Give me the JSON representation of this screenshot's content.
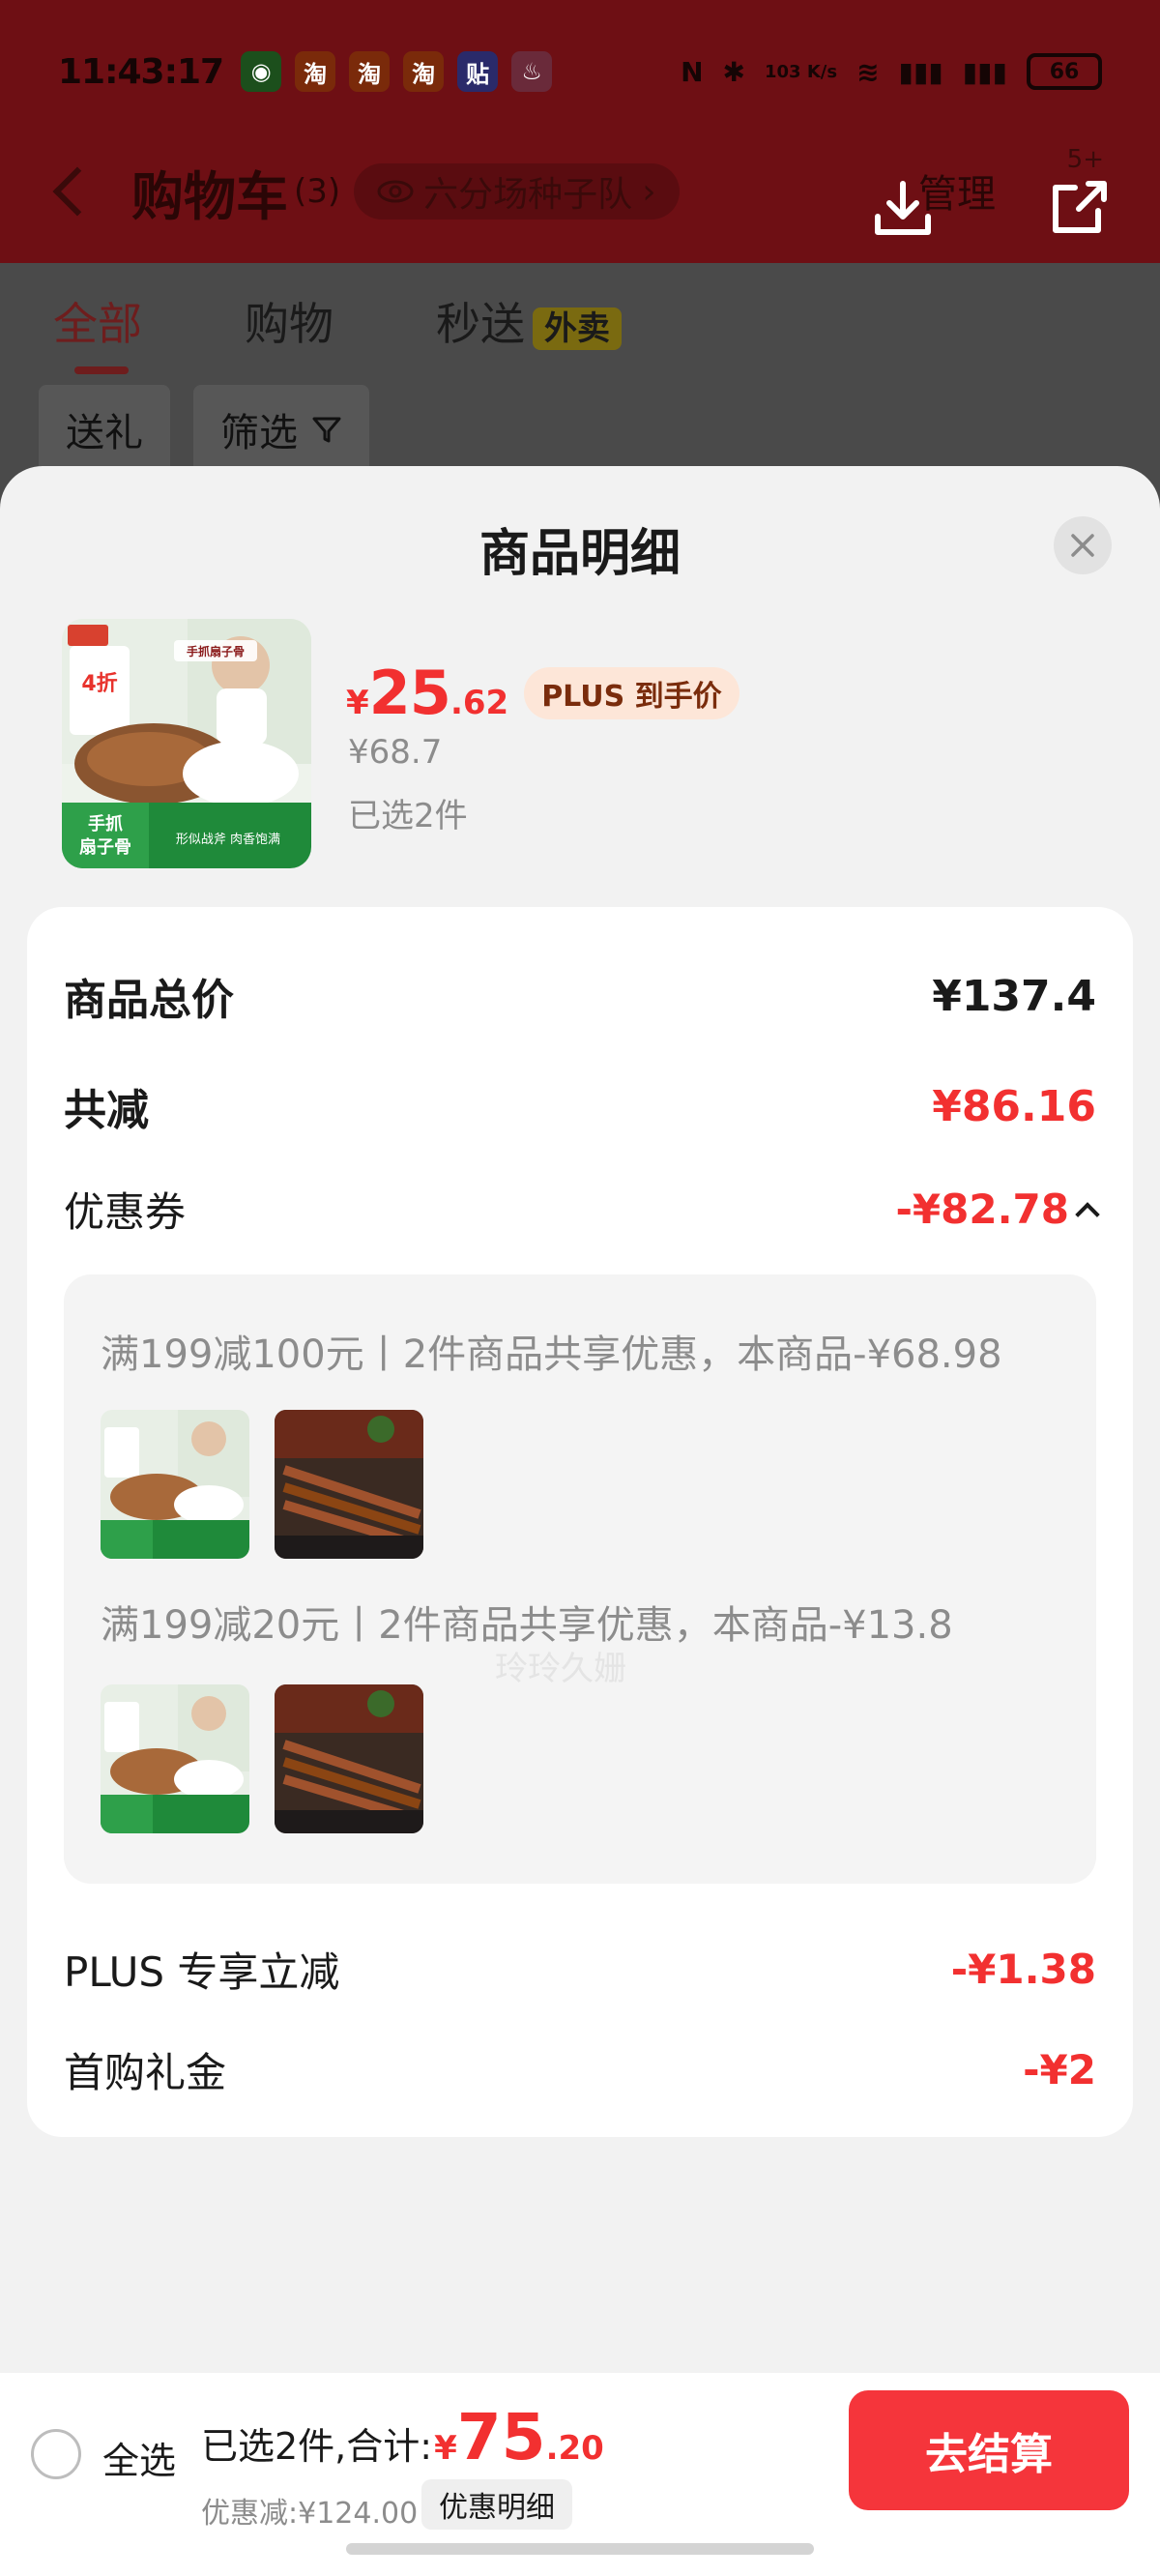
{
  "status_bar": {
    "time": "11:43:17",
    "battery": "66",
    "speed": "103 K/s"
  },
  "nav": {
    "title": "购物车",
    "count": "(3)",
    "team": "六分场种子队",
    "manage": "管理",
    "badge": "5+"
  },
  "tabs": {
    "all": "全部",
    "shop": "购物",
    "instant": "秒送",
    "takeout": "外卖"
  },
  "filters": {
    "gift": "送礼",
    "filter": "筛选"
  },
  "sheet": {
    "title": "商品明细",
    "product": {
      "price_symbol": "¥",
      "price_int": "25",
      "price_dec": ".62",
      "plus_tag": "PLUS 到手价",
      "original_price": "¥68.7",
      "selected": "已选2件",
      "img_text_brand": "手抓扇子骨",
      "img_text_left": "手抓\n扇子骨",
      "img_text_slogan": "形似战斧 肉香饱满"
    },
    "summary": {
      "total_label": "商品总价",
      "total_value": "¥137.4",
      "reduce_label": "共减",
      "reduce_value": "¥86.16",
      "coupon_label": "优惠券",
      "coupon_value": "-¥82.78",
      "coupons": [
        {
          "desc": "满199减100元丨2件商品共享优惠，本商品-¥68.98"
        },
        {
          "desc": "满199减20元丨2件商品共享优惠，本商品-¥13.8"
        }
      ],
      "plus_label": "PLUS 专享立减",
      "plus_value": "-¥1.38",
      "first_label": "首购礼金",
      "first_value": "-¥2"
    },
    "watermark": "玲玲久姗"
  },
  "bottom": {
    "select_all": "全选",
    "total_prefix": "已选2件,合计:",
    "sym": "¥",
    "int": "75",
    "dec": ".20",
    "discount": "优惠减:¥124.00",
    "detail": "优惠明细",
    "checkout": "去结算"
  },
  "colors": {
    "accent_red": "#f23030",
    "checkout_red": "#f5353b",
    "plus_tag_bg": "#fde6d8"
  }
}
